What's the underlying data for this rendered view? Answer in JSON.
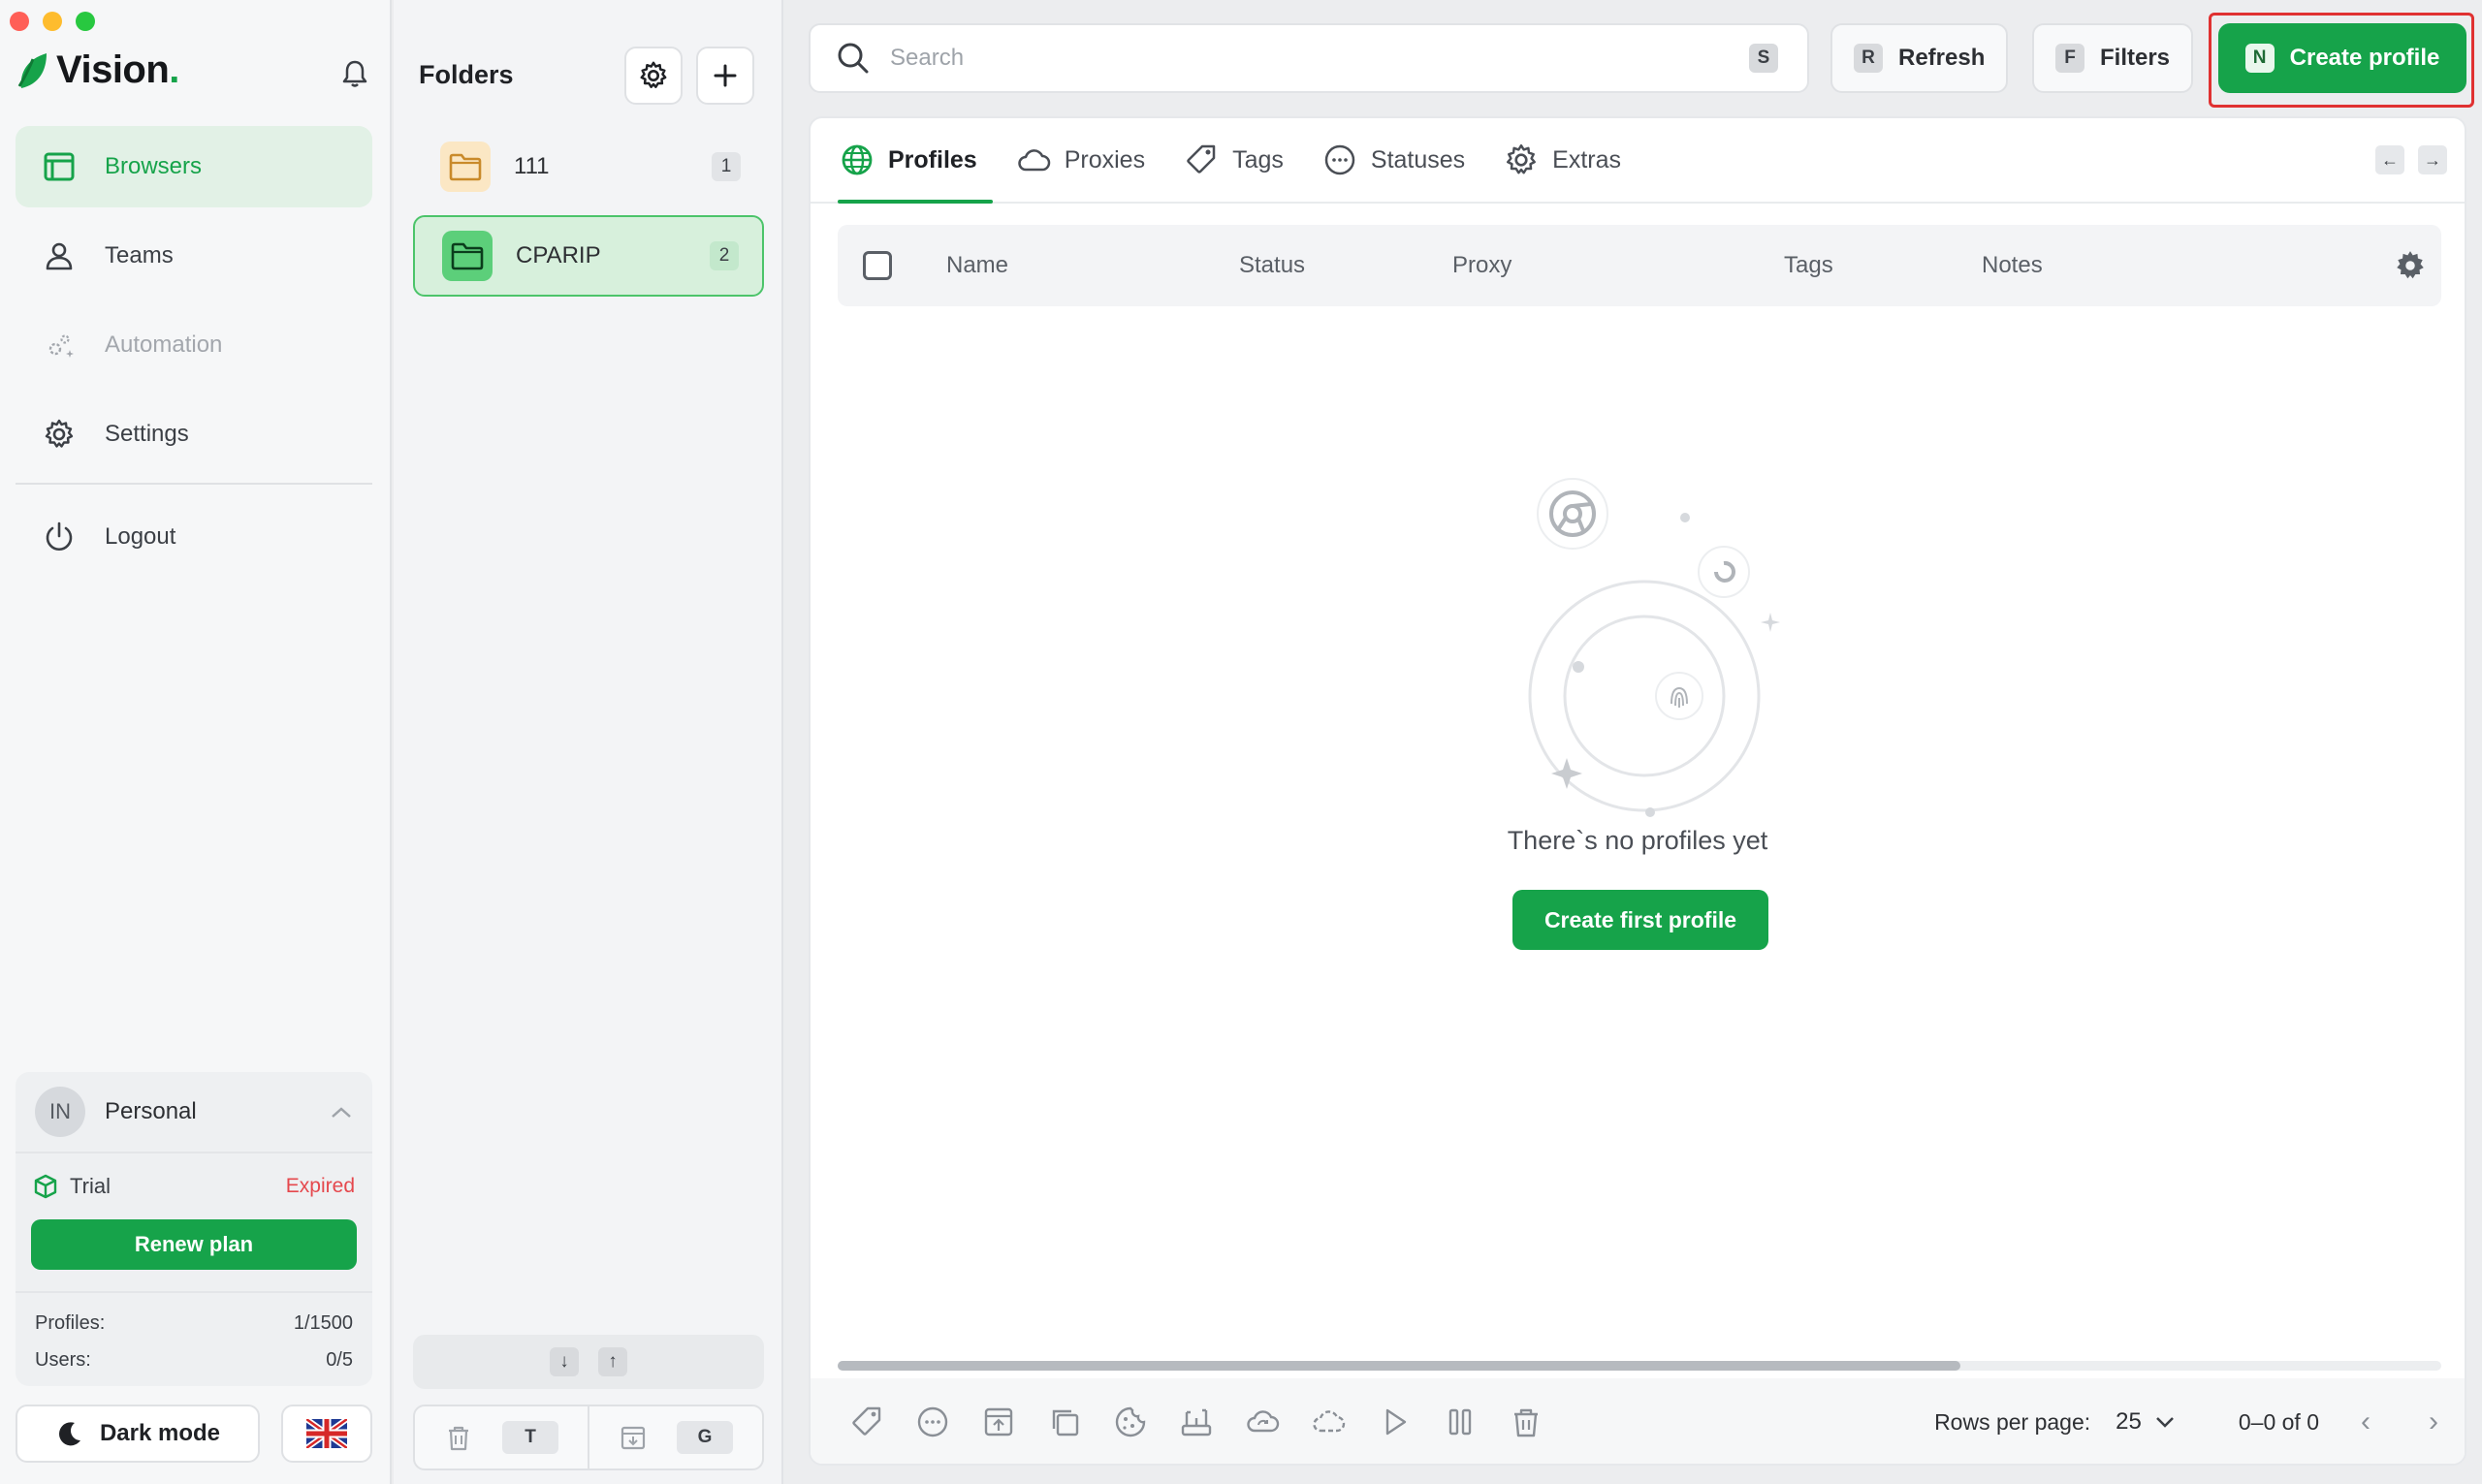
{
  "window": {
    "controls": {
      "close_color": "#ff5f57",
      "minimize_color": "#febc2e",
      "maximize_color": "#28c840"
    }
  },
  "brand": {
    "name": "Vision",
    "dot": ".",
    "accent": "#16a34a"
  },
  "sidebar": {
    "items": [
      {
        "label": "Browsers",
        "icon": "browser-window-icon",
        "state": "active"
      },
      {
        "label": "Teams",
        "icon": "user-icon",
        "state": "normal"
      },
      {
        "label": "Automation",
        "icon": "sparkle-gears-icon",
        "state": "disabled"
      },
      {
        "label": "Settings",
        "icon": "gear-icon",
        "state": "normal"
      },
      {
        "label": "Logout",
        "icon": "power-icon",
        "state": "normal"
      }
    ],
    "account": {
      "initials": "IN",
      "name": "Personal",
      "plan_label": "Trial",
      "plan_status": "Expired",
      "renew_label": "Renew plan",
      "profiles_label": "Profiles:",
      "profiles_value": "1/1500",
      "users_label": "Users:",
      "users_value": "0/5"
    },
    "dark_mode_label": "Dark mode",
    "language_flag": "uk-flag-icon"
  },
  "folders": {
    "title": "Folders",
    "items": [
      {
        "name": "111",
        "count": "1",
        "active": false,
        "color": "#f3b452"
      },
      {
        "name": "CPARIP",
        "count": "2",
        "active": true,
        "color": "#16a34a"
      }
    ],
    "sort_down": "↓",
    "sort_up": "↑",
    "delete_shortcut": "T",
    "archive_shortcut": "G"
  },
  "toolbar": {
    "search_placeholder": "Search",
    "search_shortcut": "S",
    "refresh_shortcut": "R",
    "refresh_label": "Refresh",
    "filters_shortcut": "F",
    "filters_label": "Filters",
    "create_shortcut": "N",
    "create_label": "Create profile"
  },
  "tabs": [
    {
      "label": "Profiles",
      "icon": "globe-icon",
      "active": true
    },
    {
      "label": "Proxies",
      "icon": "cloud-icon",
      "active": false
    },
    {
      "label": "Tags",
      "icon": "tag-icon",
      "active": false
    },
    {
      "label": "Statuses",
      "icon": "dots-circle-icon",
      "active": false
    },
    {
      "label": "Extras",
      "icon": "gear-icon",
      "active": false
    }
  ],
  "tab_nav": {
    "prev": "←",
    "next": "→"
  },
  "table": {
    "columns": [
      "Name",
      "Status",
      "Proxy",
      "Tags",
      "Notes"
    ]
  },
  "empty_state": {
    "title": "There`s no profiles yet",
    "cta_label": "Create first profile"
  },
  "scrollbar": {
    "thumb_fraction": 0.7
  },
  "pagination": {
    "rows_label": "Rows per page:",
    "rows_value": "25",
    "range": "0–0 of 0"
  }
}
